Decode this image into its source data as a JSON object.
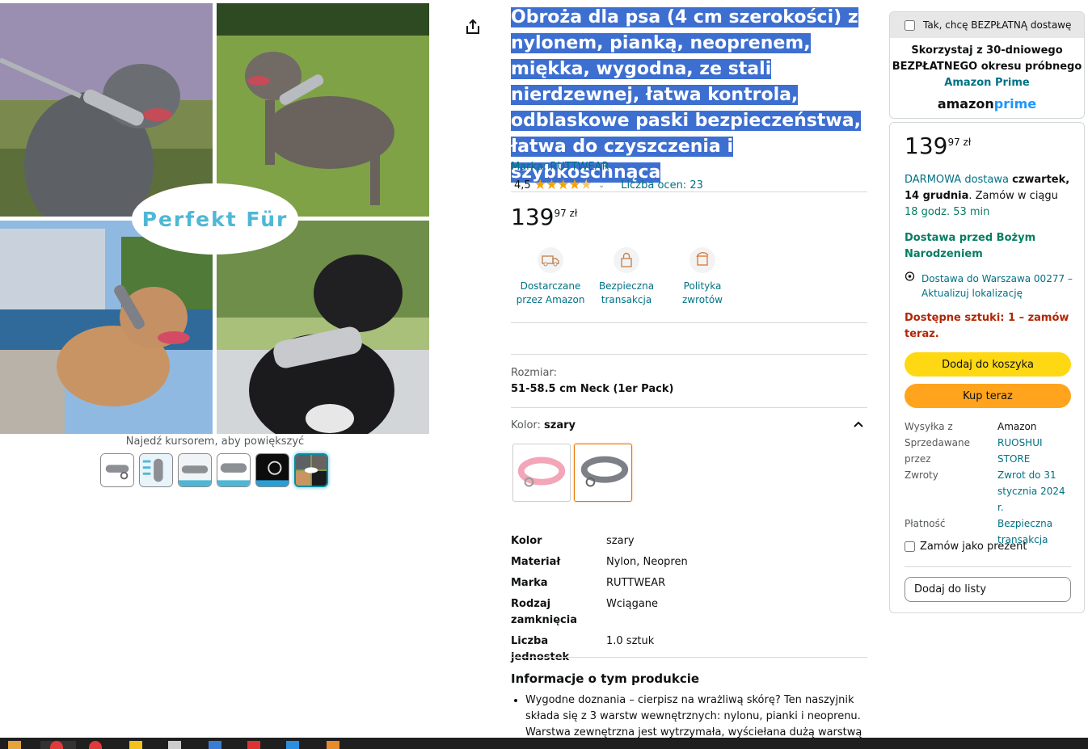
{
  "gallery": {
    "overlay_text": "Perfekt Für",
    "hover_hint": "Najedź kursorem, aby powiększyć",
    "thumbnail_count": 6
  },
  "product": {
    "title": "Obroża dla psa (4 cm szerokości) z nylonem, pianką, neoprenem, miękka, wygodna, ze stali nierdzewnej, łatwa kontrola, odblaskowe paski bezpieczeństwa, łatwa do czyszczenia i szybkoschnąca",
    "brand_link": "Marka: RUTTWEAR",
    "rating_value": "4,5",
    "rating_stars": 4.5,
    "rating_count": "Liczba ocen: 23",
    "price_whole": "139",
    "price_fraction": "97 zł",
    "badges": [
      {
        "label": "Dostarczane przez Amazon",
        "icon": "delivery-truck-icon"
      },
      {
        "label": "Bezpieczna transakcja",
        "icon": "lock-icon"
      },
      {
        "label": "Polityka zwrotów",
        "icon": "return-icon"
      }
    ],
    "size_label": "Rozmiar:",
    "size_value": "51-58.5 cm Neck (1er Pack)",
    "color_label": "Kolor: ",
    "color_value": "szary",
    "specs": [
      {
        "key": "Kolor",
        "value": "szary"
      },
      {
        "key": "Materiał",
        "value": "Nylon, Neopren"
      },
      {
        "key": "Marka",
        "value": "RUTTWEAR"
      },
      {
        "key": "Rodzaj zamknięcia",
        "value": "Wciągane"
      },
      {
        "key": "Liczba jednostek",
        "value": "1.0 sztuk"
      }
    ],
    "info_title": "Informacje o tym produkcie",
    "bullet_1": "Wygodne doznania – cierpisz na wrażliwą skórę? Ten naszyjnik składa się z 3 warstw wewnętrznych: nylonu, pianki i neoprenu. Warstwa zewnętrzna jest wytrzymała, wyściełana dużą warstwą"
  },
  "prime": {
    "checkbox_label": "Tak, chcę BEZPŁATNĄ dostawę",
    "line1": "Skorzystaj z 30-dniowego",
    "line2": "BEZPŁATNEGO okresu próbnego",
    "line3": "Amazon Prime",
    "logo_a": "amazon",
    "logo_p": "prime"
  },
  "buybox": {
    "price_whole": "139",
    "price_fraction": "97 zł",
    "delivery_link": "DARMOWA dostawa",
    "delivery_day": "czwartek, 14 grudnia",
    "delivery_mid": ". Zamów w ciągu ",
    "delivery_time": "18 godz. 53 min",
    "xmas": "Dostawa przed Bożym Narodzeniem",
    "location": "Dostawa do Warszawa 00277 – Aktualizuj lokalizację",
    "stock": "Dostępne sztuki: 1 – zamów teraz.",
    "add_to_cart": "Dodaj do koszyka",
    "buy_now": "Kup teraz",
    "ship_from_k": "Wysyłka z",
    "ship_from_v": "Amazon",
    "sold_by_k": "Sprzedawane przez",
    "sold_by_v": "RUOSHUI STORE",
    "returns_k": "Zwroty",
    "returns_v": "Zwrot do 31 stycznia 2024 r.",
    "payment_k": "Płatność",
    "payment_v": "Bezpieczna transakcja",
    "gift": "Zamów jako prezent",
    "add_to_list": "Dodaj do listy"
  },
  "colors": {
    "title_highlight": "#3d6fd1",
    "link": "#007185",
    "cart_button": "#FFD814",
    "buy_button": "#FFA41C",
    "stock_red": "#B12704",
    "green": "#067D62"
  }
}
